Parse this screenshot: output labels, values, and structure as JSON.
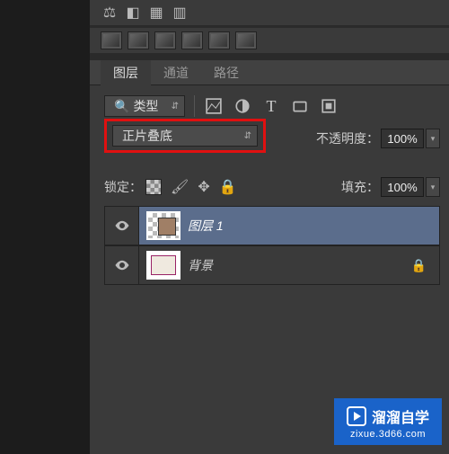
{
  "tabs": {
    "layers": "图层",
    "channels": "通道",
    "paths": "路径"
  },
  "filter_row": {
    "kind_label": "类型",
    "icons": [
      "image-icon",
      "adjust-icon",
      "type-icon",
      "shape-icon",
      "smart-icon"
    ]
  },
  "blend_mode": {
    "value": "正片叠底"
  },
  "opacity": {
    "label": "不透明度：",
    "value": "100%"
  },
  "lock": {
    "label": "锁定：",
    "fill_label": "填充：",
    "fill_value": "100%"
  },
  "layers": [
    {
      "name": "图层 1",
      "selected": true,
      "locked": false
    },
    {
      "name": "背景",
      "selected": false,
      "locked": true
    }
  ],
  "watermark": {
    "title": "溜溜自学",
    "url": "zixue.3d66.com"
  }
}
